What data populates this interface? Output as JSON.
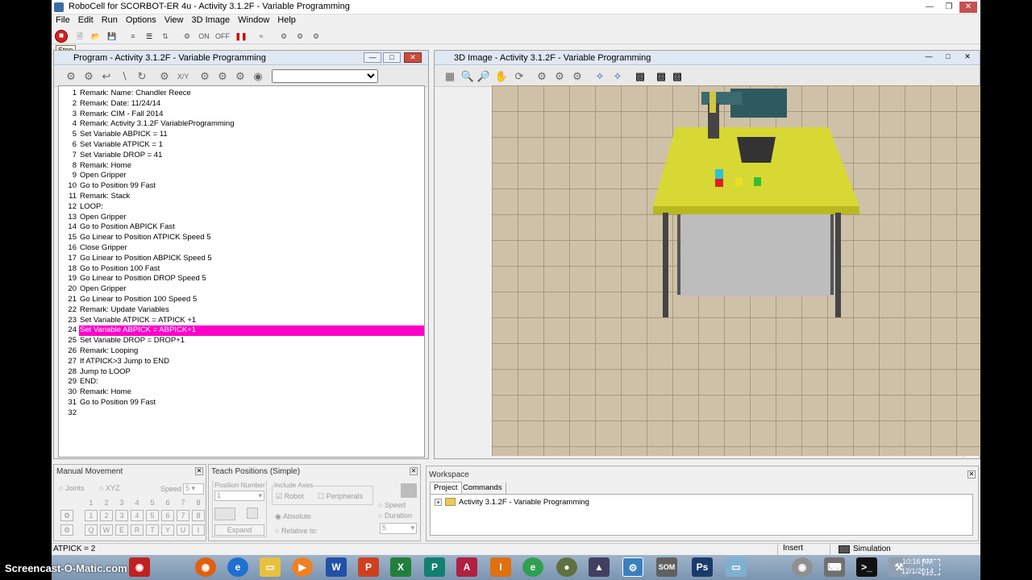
{
  "window": {
    "title": "RoboCell for SCORBOT-ER 4u - Activity 3.1.2F - Variable Programming"
  },
  "menu": [
    "File",
    "Edit",
    "Run",
    "Options",
    "View",
    "3D Image",
    "Window",
    "Help"
  ],
  "toolbar": {
    "stop_tooltip": "Stop",
    "on_label": "ON",
    "off_label": "OFF"
  },
  "program_window": {
    "title": "Program - Activity 3.1.2F - Variable Programming",
    "xy_label": "X/Y",
    "selected_line": 24,
    "lines": [
      {
        "n": "1",
        "text": "Remark: Name: Chandler Reece"
      },
      {
        "n": "2",
        "text": "Remark: Date: 11/24/14"
      },
      {
        "n": "3",
        "text": "Remark: CIM - Fall 2014"
      },
      {
        "n": "4",
        "text": "Remark: Activity 3.1.2F VariableProgramming"
      },
      {
        "n": "5",
        "text": "Set Variable ABPICK  = 11"
      },
      {
        "n": "6",
        "text": "Set Variable ATPICK  = 1"
      },
      {
        "n": "7",
        "text": "Set Variable DROP  = 41"
      },
      {
        "n": "8",
        "text": "Remark: Home"
      },
      {
        "n": "9",
        "text": "Open Gripper"
      },
      {
        "n": "10",
        "text": "Go to Position 99 Fast"
      },
      {
        "n": "11",
        "text": "Remark: Stack"
      },
      {
        "n": "12",
        "text": "LOOP:"
      },
      {
        "n": "13",
        "text": "Open Gripper"
      },
      {
        "n": "14",
        "text": "Go to Position ABPICK Fast"
      },
      {
        "n": "15",
        "text": "Go Linear to Position ATPICK Speed 5"
      },
      {
        "n": "16",
        "text": "Close Gripper"
      },
      {
        "n": "17",
        "text": "Go Linear to Position ABPICK Speed 5"
      },
      {
        "n": "18",
        "text": "Go to Position 100 Fast"
      },
      {
        "n": "19",
        "text": "Go Linear to Position DROP Speed 5"
      },
      {
        "n": "20",
        "text": "Open Gripper"
      },
      {
        "n": "21",
        "text": "Go Linear to Position 100 Speed 5"
      },
      {
        "n": "22",
        "text": "Remark: Update Variables"
      },
      {
        "n": "23",
        "text": "Set Variable ATPICK  = ATPICK +1"
      },
      {
        "n": "24",
        "text": "Set Variable ABPICK  = ABPICK+1"
      },
      {
        "n": "25",
        "text": "Set Variable DROP  = DROP+1"
      },
      {
        "n": "26",
        "text": "Remark: Looping"
      },
      {
        "n": "27",
        "text": "If ATPICK>3 Jump to END"
      },
      {
        "n": "28",
        "text": "Jump to LOOP"
      },
      {
        "n": "29",
        "text": "END:"
      },
      {
        "n": "30",
        "text": "Remark: Home"
      },
      {
        "n": "31",
        "text": "Go to Position 99 Fast"
      },
      {
        "n": "32",
        "text": ""
      }
    ]
  },
  "image_window": {
    "title": "3D Image - Activity 3.1.2F - Variable Programming"
  },
  "manual_movement": {
    "title": "Manual Movement",
    "joints_label": "Joints",
    "xyz_label": "XYZ",
    "speed_label": "Speed",
    "speed_value": "5",
    "axis_numbers": [
      "1",
      "2",
      "3",
      "4",
      "5",
      "6",
      "7",
      "8"
    ],
    "axis_plus": [
      "1",
      "2",
      "3",
      "4",
      "5",
      "6",
      "7",
      "8"
    ],
    "axis_minus": [
      "Q",
      "W",
      "E",
      "R",
      "T",
      "Y",
      "U",
      "I"
    ]
  },
  "teach_positions": {
    "title": "Teach Positions (Simple)",
    "position_number_label": "Position Number",
    "position_number_value": "1",
    "include_axes_label": "Include Axes",
    "robot_label": "Robot",
    "peripherals_label": "Peripherals",
    "absolute_label": "Absolute",
    "relative_label": "Relative to:",
    "expand_label": "Expand",
    "speed_label": "Speed",
    "duration_label": "Duration",
    "speed_value": "5"
  },
  "workspace": {
    "title": "Workspace",
    "tabs": [
      "Project",
      "Commands"
    ],
    "tree_item": "Activity 3.1.2F - Variable Programming"
  },
  "statusbar": {
    "variable": "ATPICK  = 2",
    "mode": "Insert",
    "sim": "Simulation"
  },
  "taskbar": {
    "watermark": "Screencast-O-Matic.com",
    "time": "10:16 AM",
    "date": "12/1/2014"
  }
}
